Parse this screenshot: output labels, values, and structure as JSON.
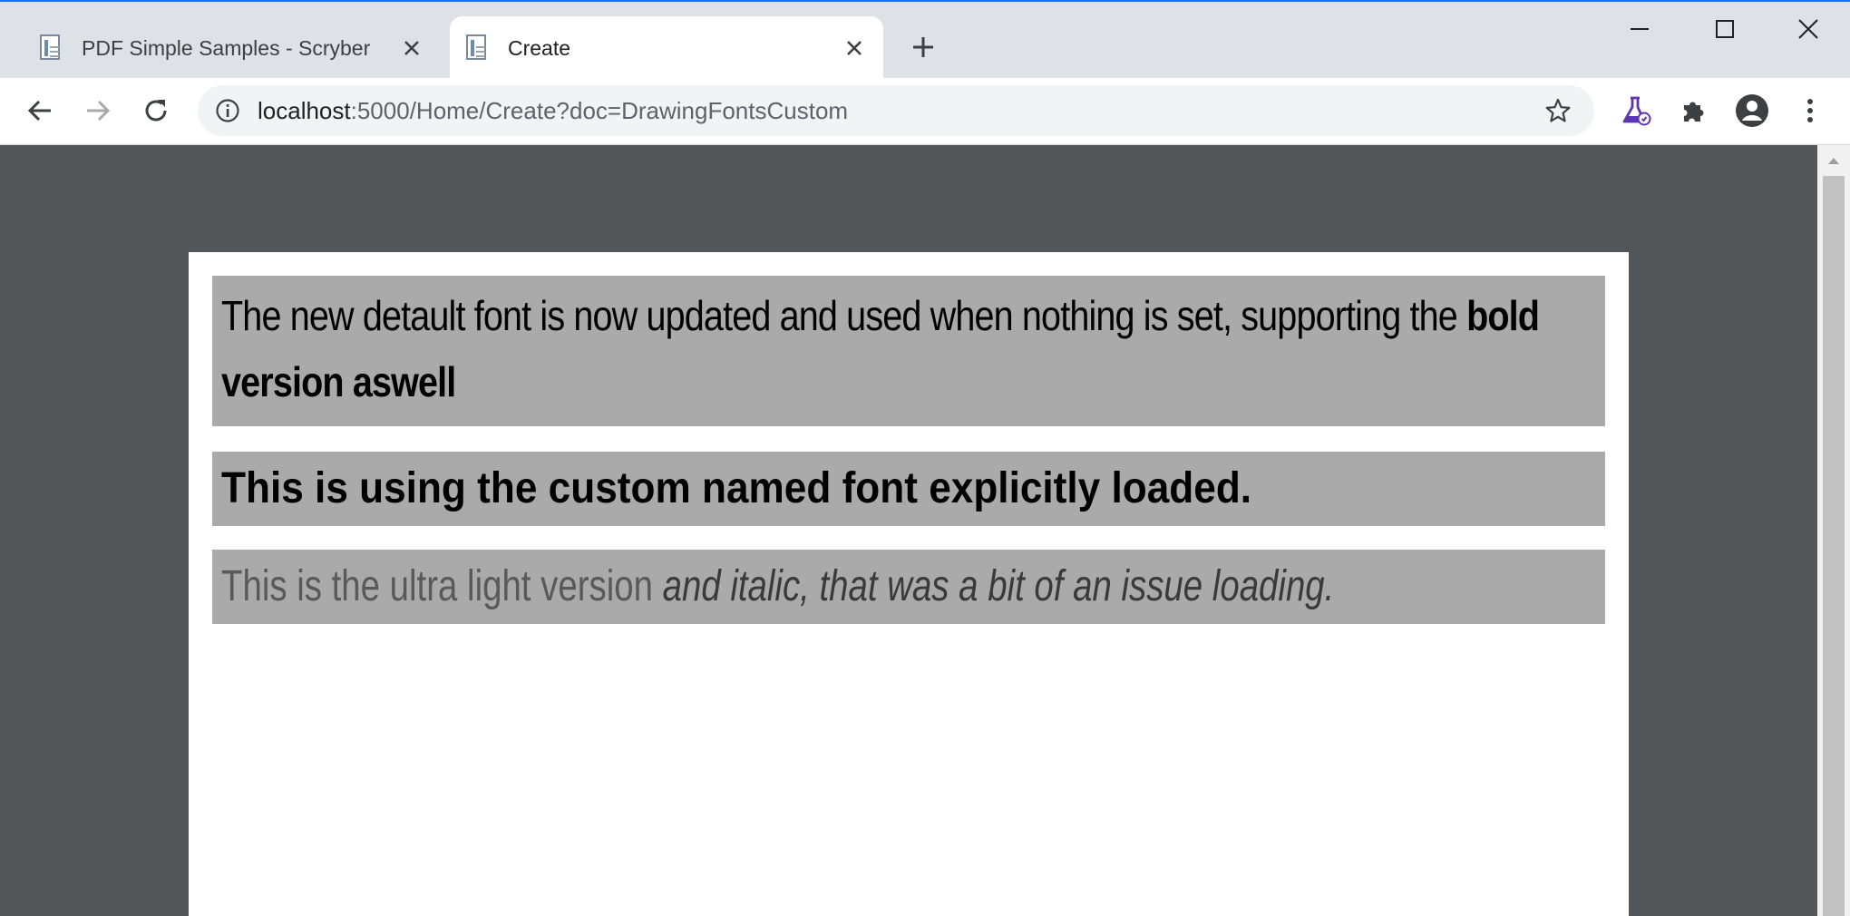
{
  "browser": {
    "tabs": [
      {
        "title": "PDF Simple Samples - Scryber",
        "active": false
      },
      {
        "title": "Create",
        "active": true
      }
    ],
    "address": {
      "host": "localhost",
      "path": ":5000/Home/Create?doc=DrawingFontsCustom"
    },
    "icons": {
      "back": "back-arrow-icon",
      "forward": "forward-arrow-icon",
      "reload": "reload-icon",
      "info": "info-icon",
      "star": "star-icon",
      "labs": "flask-icon",
      "extensions": "puzzle-icon",
      "profile": "account-icon",
      "menu": "kebab-menu-icon",
      "new_tab": "plus-icon",
      "minimize": "minimize-icon",
      "maximize": "maximize-icon",
      "close": "close-icon"
    },
    "colors": {
      "accent": "#1a73e8",
      "labs_icon": "#5e35b1",
      "viewer_bg": "#525659"
    }
  },
  "document": {
    "block1": {
      "text": "The new detault font is now updated and used when nothing is set, supporting the ",
      "bold": "bold version aswell"
    },
    "block2": {
      "text": "This is using the custom named font explicitly loaded."
    },
    "block3": {
      "light": "This is the ultra light version ",
      "italic": "and italic, that was a bit of an issue loading."
    }
  }
}
